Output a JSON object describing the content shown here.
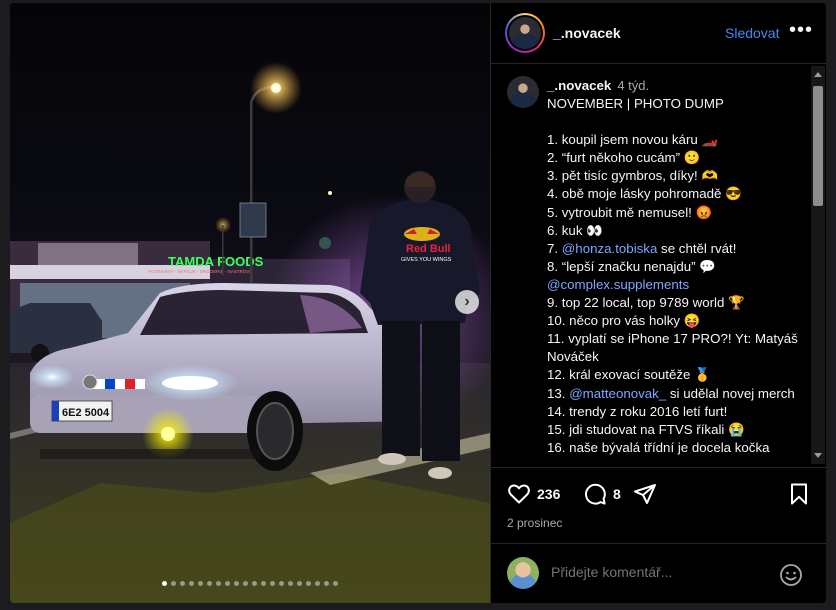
{
  "post": {
    "username": "_.novacek",
    "follow_label": "Sledovat",
    "more_label": "•••",
    "time_ago": "4 týd.",
    "title": "NOVEMBER | PHOTO DUMP",
    "caption_lines": [
      {
        "text": "1. koupil jsem novou káru 🏎️"
      },
      {
        "text": "2. “furt někoho cucám” 🙂"
      },
      {
        "text": "3. pět tisíc gymbros, díky! 🫶"
      },
      {
        "text": "4. obě moje lásky pohromadě 😎"
      },
      {
        "text": "5. vytroubit mě nemusel! 😡"
      },
      {
        "text": "6. kuk 👀"
      },
      {
        "mention": "@honza.tobiska",
        "text": " se chtěl rvát!",
        "prefix": "7. "
      },
      {
        "text": "8. “lepší značku nenajdu” 💬"
      },
      {
        "mention": "@complex.supplements",
        "text": "",
        "prefix": ""
      },
      {
        "text": "9. top 22 local, top 9789 world 🏆"
      },
      {
        "text": "10. něco pro vás holky 😝"
      },
      {
        "text": "11. vyplatí se iPhone 17 PRO?! Yt: Matyáš Nováček"
      },
      {
        "text": "12. král exovací soutěže 🥇"
      },
      {
        "mention": "@matteonovak_",
        "text": " si udělal novej merch",
        "prefix": "13. "
      },
      {
        "text": "14. trendy z roku 2016 letí furt!"
      },
      {
        "text": "15. jdi studovat na FTVS říkali 😭"
      },
      {
        "text": "16. naše bývalá třídní je docela kočka"
      }
    ],
    "likes": "236",
    "comments": "8",
    "date": "2 prosinec",
    "comment_placeholder": "Přidejte komentář...",
    "carousel": {
      "total": 20,
      "active": 0
    },
    "photo_texts": {
      "store_sign": "TAMDA FOODS",
      "store_sub": "POTRAVINY · NÁPOJE · DROGERIE · NASTROVÍ",
      "plate": "6E2 5004",
      "hoodie_brand": "Red Bull",
      "hoodie_tag": "GIVES YOU WINGS"
    }
  },
  "colors": {
    "accent": "#4a88e8",
    "mention": "#7ea7ff",
    "store_sign": "#3cff5a",
    "fog_light": "#f6f000"
  }
}
